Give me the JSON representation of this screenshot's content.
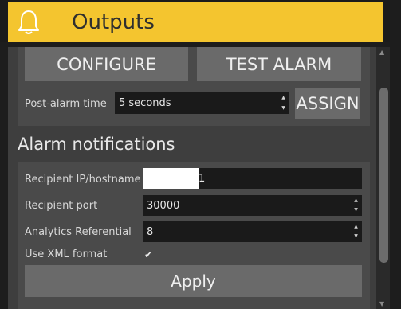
{
  "header": {
    "title": "Outputs",
    "icon": "bell-icon",
    "accent": "#f4c52f"
  },
  "top_actions": {
    "configure_label": "CONFIGURE",
    "test_alarm_label": "TEST ALARM",
    "post_alarm_label": "Post-alarm time",
    "post_alarm_value": "5 seconds",
    "assign_label": "ASSIGN"
  },
  "alarm": {
    "section_title": "Alarm notifications",
    "recipient_host_label": "Recipient  IP/hostname",
    "recipient_host_visible": "1",
    "recipient_port_label": "Recipient port",
    "recipient_port_value": "30000",
    "analytics_label": "Analytics Referential",
    "analytics_value": "8",
    "xml_label": "Use XML format",
    "xml_checked": true,
    "apply_label": "Apply"
  }
}
